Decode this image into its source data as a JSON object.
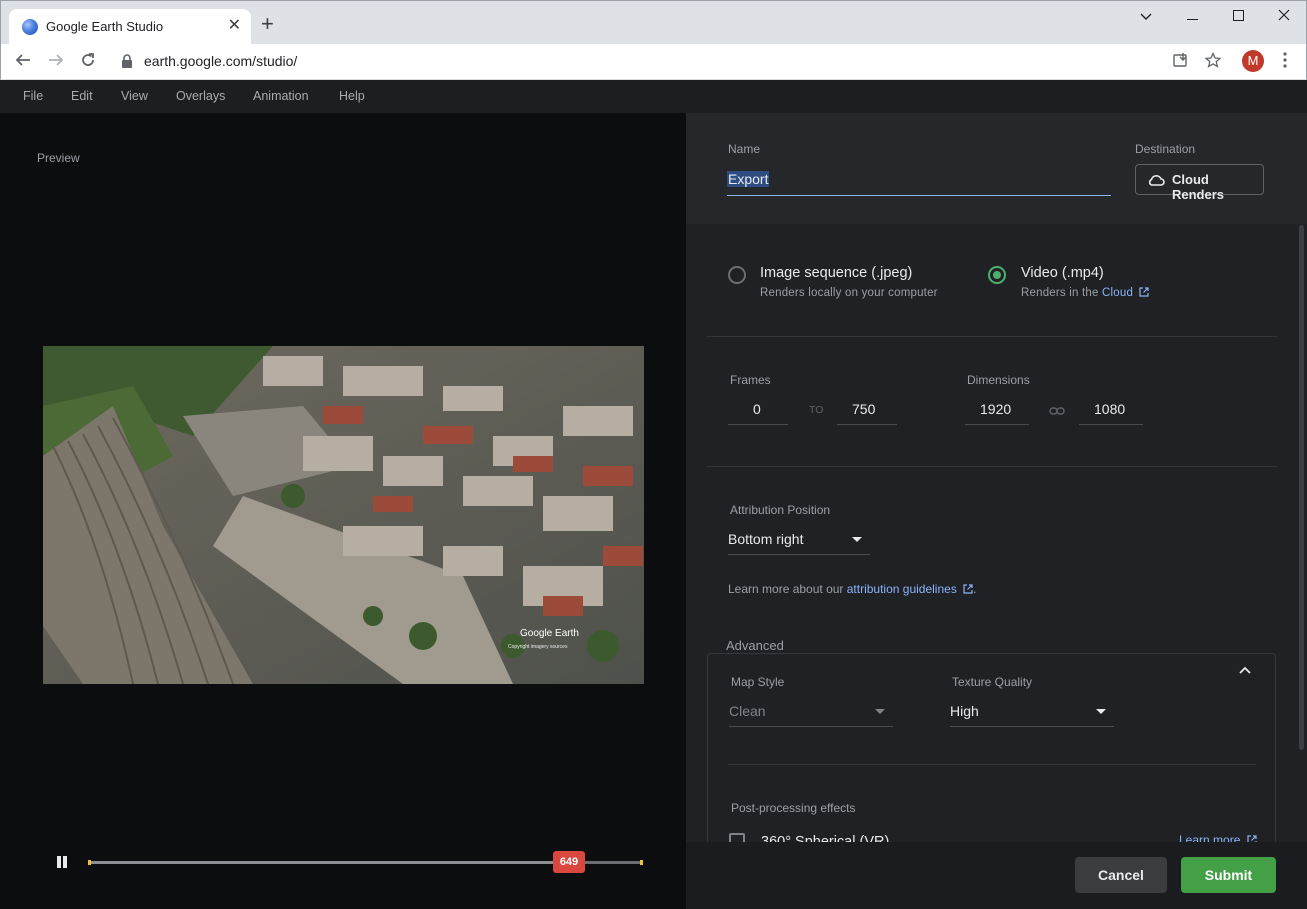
{
  "browser": {
    "tab_title": "Google Earth Studio",
    "url": "earth.google.com/studio/",
    "avatar_letter": "M"
  },
  "menu": [
    "File",
    "Edit",
    "View",
    "Overlays",
    "Animation",
    "Help"
  ],
  "preview": {
    "label": "Preview",
    "current_frame": "649",
    "progress_fraction": 0.865,
    "watermark": "Google Earth",
    "watermark_sub": "Copyright imagery sources"
  },
  "export": {
    "name_label": "Name",
    "name_value": "Export",
    "destination_label": "Destination",
    "destination_value": "Cloud Renders",
    "options": [
      {
        "title": "Image sequence (.jpeg)",
        "subtitle": "Renders locally on your computer",
        "selected": false
      },
      {
        "title": "Video (.mp4)",
        "subtitle_prefix": "Renders in the ",
        "subtitle_link": "Cloud",
        "selected": true
      }
    ],
    "frames_label": "Frames",
    "frame_start": "0",
    "frame_to": "TO",
    "frame_end": "750",
    "dimensions_label": "Dimensions",
    "width": "1920",
    "height": "1080",
    "attribution_label": "Attribution Position",
    "attribution_value": "Bottom right",
    "learn_prefix": "Learn more about our ",
    "learn_link": "attribution guidelines",
    "learn_suffix": ".",
    "advanced_label": "Advanced",
    "map_style_label": "Map Style",
    "map_style_value": "Clean",
    "texture_label": "Texture Quality",
    "texture_value": "High",
    "post_label": "Post-processing effects",
    "spherical_label": "360° Spherical (VR)",
    "learn_more": "Learn more",
    "cancel": "Cancel",
    "submit": "Submit"
  },
  "colors": {
    "accent_green": "#43a047",
    "radio_green": "#4caf6e",
    "link_blue": "#8ab4f8",
    "badge_red": "#d9473e"
  }
}
